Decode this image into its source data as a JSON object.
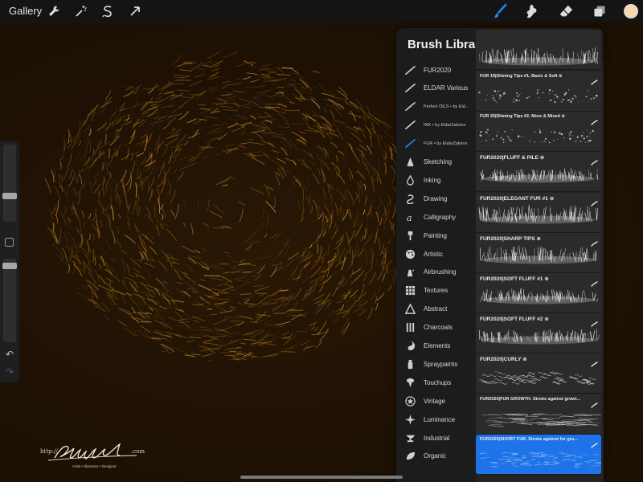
{
  "toolbar": {
    "gallery_label": "Gallery",
    "left_icons": [
      "wrench-icon",
      "magic-wand-icon",
      "selection-icon",
      "transform-arrow-icon"
    ],
    "right_icons": [
      "brush-icon",
      "smudge-icon",
      "eraser-icon",
      "layers-icon"
    ],
    "active_tool": "brush",
    "current_color": "#f9d7b5",
    "active_tool_color": "#2b84ff"
  },
  "signature": {
    "url_left": "http://",
    "url_right": ".com",
    "subtitle": "Artist • Illustrator • Designer"
  },
  "brush_library": {
    "title": "Brush Library",
    "add_label": "+",
    "categories": [
      {
        "label": "FUR2020",
        "icon": "imported-brush-icon",
        "small": false,
        "active": false
      },
      {
        "label": "ELDAR Various",
        "icon": "imported-brush-icon",
        "small": false,
        "active": false
      },
      {
        "label": "Perfect OILS • by Eld...",
        "icon": "imported-brush-icon",
        "small": true,
        "active": false
      },
      {
        "label": "INK • by EldarZakirov",
        "icon": "imported-brush-icon",
        "small": true,
        "active": false
      },
      {
        "label": "FUR • by EldarZakirov",
        "icon": "imported-brush-icon",
        "small": true,
        "active": true
      },
      {
        "label": "Sketching",
        "icon": "pencil-tip-icon",
        "small": false,
        "active": false
      },
      {
        "label": "Inking",
        "icon": "ink-drop-icon",
        "small": false,
        "active": false
      },
      {
        "label": "Drawing",
        "icon": "swirl-icon",
        "small": false,
        "active": false
      },
      {
        "label": "Calligraphy",
        "icon": "calligraphy-a-icon",
        "small": false,
        "active": false
      },
      {
        "label": "Painting",
        "icon": "paintbrush-icon",
        "small": false,
        "active": false
      },
      {
        "label": "Artistic",
        "icon": "palette-icon",
        "small": false,
        "active": false
      },
      {
        "label": "Airbrushing",
        "icon": "airbrush-icon",
        "small": false,
        "active": false
      },
      {
        "label": "Textures",
        "icon": "texture-grid-icon",
        "small": false,
        "active": false
      },
      {
        "label": "Abstract",
        "icon": "triangle-icon",
        "small": false,
        "active": false
      },
      {
        "label": "Charcoals",
        "icon": "charcoal-bars-icon",
        "small": false,
        "active": false
      },
      {
        "label": "Elements",
        "icon": "yin-yang-icon",
        "small": false,
        "active": false
      },
      {
        "label": "Spraypaints",
        "icon": "spray-can-icon",
        "small": false,
        "active": false
      },
      {
        "label": "Touchups",
        "icon": "touchup-icon",
        "small": false,
        "active": false
      },
      {
        "label": "Vintage",
        "icon": "star-badge-icon",
        "small": false,
        "active": false
      },
      {
        "label": "Luminance",
        "icon": "sparkle-icon",
        "small": false,
        "active": false
      },
      {
        "label": "Industrial",
        "icon": "anvil-icon",
        "small": false,
        "active": false
      },
      {
        "label": "Organic",
        "icon": "leaf-icon",
        "small": false,
        "active": false
      }
    ],
    "brushes": [
      {
        "name": "FUR 19|Shining Tips #1, Basic & Soft ⊚",
        "tiny": true,
        "active": false,
        "style": "dots"
      },
      {
        "name": "FUR 20|Shining Tips #2, More & Mixed ⊚",
        "tiny": true,
        "active": false,
        "style": "dots"
      },
      {
        "name": "FUR2020|FLUFF & PILE ⊚",
        "tiny": false,
        "active": false,
        "style": "fluff"
      },
      {
        "name": "FUR2020|ELEGANT FUR #1 ⊚",
        "tiny": false,
        "active": false,
        "style": "spikes"
      },
      {
        "name": "FUR2020|SHARP TIPS ⊚",
        "tiny": false,
        "active": false,
        "style": "sharp"
      },
      {
        "name": "FUR2020|SOFT FLUFF #1 ⊚",
        "tiny": false,
        "active": false,
        "style": "fluff"
      },
      {
        "name": "FUR2020|SOFT FLUFF #2 ⊚",
        "tiny": false,
        "active": false,
        "style": "fluff"
      },
      {
        "name": "FUR2020|CURLY ⊚",
        "tiny": false,
        "active": false,
        "style": "curly"
      },
      {
        "name": "FUR2020|FUR GROWTH. Stroke against growt...",
        "tiny": true,
        "active": false,
        "style": "soft"
      },
      {
        "name": "FUR2020|SHORT FUR. Stroke against fur gro...",
        "tiny": true,
        "active": true,
        "style": "short"
      }
    ]
  }
}
